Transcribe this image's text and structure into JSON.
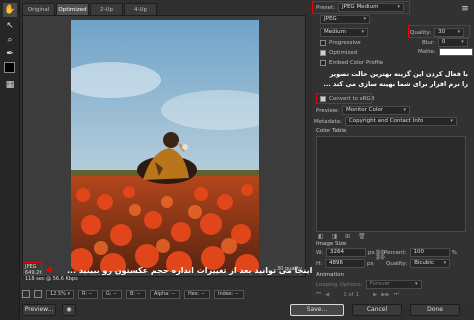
{
  "tabs": [
    "Original",
    "Optimized",
    "2-Up",
    "4-Up"
  ],
  "preset": {
    "label": "Preset:",
    "value": "JPEG Medium"
  },
  "format": "JPEG",
  "quality_level": "Medium",
  "quality": {
    "label": "Quality:",
    "value": "30"
  },
  "blur": {
    "label": "Blur:",
    "value": "0"
  },
  "matte": {
    "label": "Matte:"
  },
  "options": {
    "progressive": {
      "label": "Progressive",
      "checked": false
    },
    "optimized": {
      "label": "Optimized",
      "checked": true
    },
    "embed": {
      "label": "Embed Color Profile",
      "checked": false
    },
    "convert": {
      "label": "Convert to sRGB",
      "checked": true
    }
  },
  "annotation_top": [
    "با فعال کردن این گزینه بهترین حالت تصویر",
    "را نرم افزار برای شما بهینه سازی می کند ..."
  ],
  "preview": {
    "label": "Preview:",
    "value": "Monitor Color"
  },
  "metadata": {
    "label": "Metadata:",
    "value": "Copyright and Contact Info"
  },
  "color_table": "Color Table",
  "image_size": {
    "title": "Image Size",
    "w_label": "W:",
    "w_value": "3264",
    "h_label": "H:",
    "h_value": "4896",
    "unit": "px",
    "percent_label": "Percent:",
    "percent_value": "100",
    "percent_unit": "%",
    "quality_label": "Quality:",
    "quality_value": "Bicubic"
  },
  "animation": {
    "title": "Animation",
    "looping_label": "Looping Options:",
    "looping_value": "Forever",
    "frames": "1 of 1"
  },
  "image_info": [
    "JPEG",
    "649.2K",
    "118 sec @ 56.6 Kbps"
  ],
  "image_quality_label": "30 quality",
  "annotation_bottom": "اینجا می توانید بعد از تغییرات اندازه حجم عکستون رو ببینید ...",
  "zoom": "12.5%",
  "status_labels": [
    "R: --",
    "G: --",
    "B: --",
    "Alpha: --",
    "Hex: --",
    "Index: --"
  ],
  "buttons": {
    "preview": "Preview...",
    "save": "Save...",
    "cancel": "Cancel",
    "done": "Done"
  },
  "colors": {
    "highlight": "#ee0000",
    "panel": "#323232"
  }
}
